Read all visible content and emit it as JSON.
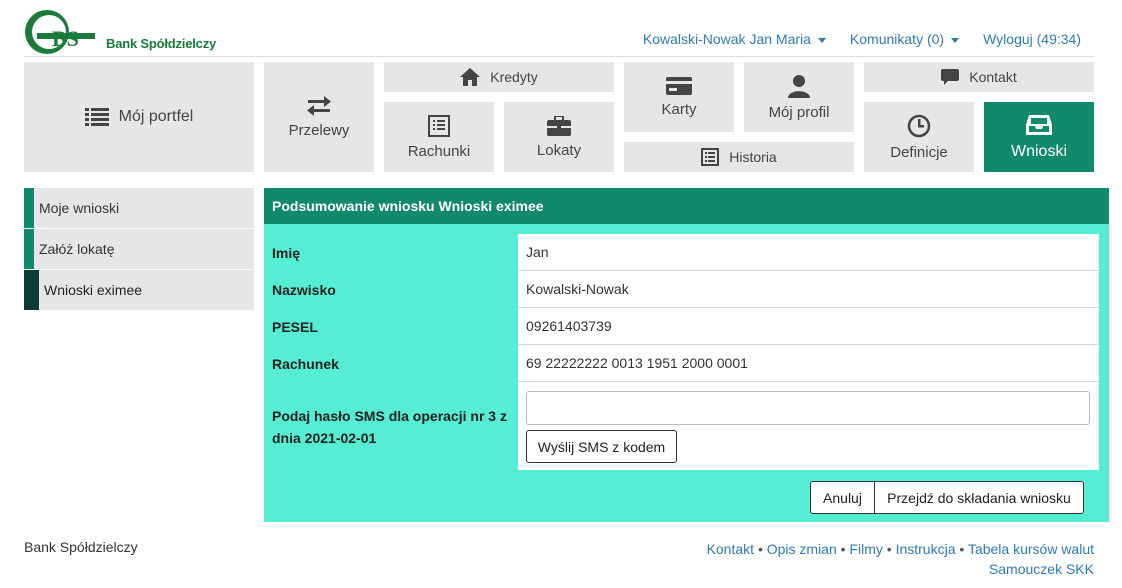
{
  "header": {
    "logo_text": "Bank Spółdzielczy",
    "user_name": "Kowalski-Nowak Jan Maria",
    "messages": "Komunikaty (0)",
    "logout": "Wyloguj (49:34)"
  },
  "tiles": {
    "portfel": "Mój portfel",
    "przelewy": "Przelewy",
    "kredyty": "Kredyty",
    "rachunki": "Rachunki",
    "lokaty": "Lokaty",
    "karty": "Karty",
    "historia": "Historia",
    "profil": "Mój profil",
    "kontakt": "Kontakt",
    "definicje": "Definicje",
    "wnioski": "Wnioski"
  },
  "sidebar": {
    "items": [
      {
        "label": "Moje wnioski"
      },
      {
        "label": "Załóż lokatę"
      },
      {
        "label": "Wnioski eximee"
      }
    ]
  },
  "panel": {
    "title": "Podsumowanie wniosku Wnioski eximee",
    "fields": [
      {
        "label": "Imię",
        "value": "Jan"
      },
      {
        "label": "Nazwisko",
        "value": "Kowalski-Nowak"
      },
      {
        "label": "PESEL",
        "value": "09261403739"
      },
      {
        "label": "Rachunek",
        "value": "69 22222222 0013 1951 2000 0001"
      }
    ],
    "sms_label": "Podaj hasło SMS dla operacji nr 3 z dnia 2021-02-01",
    "sms_value": "",
    "send_sms": "Wyślij SMS z kodem",
    "cancel": "Anuluj",
    "proceed": "Przejdź do składania wniosku"
  },
  "footer": {
    "bank": "Bank Spółdzielczy",
    "links": [
      "Kontakt",
      "Opis zmian",
      "Filmy",
      "Instrukcja",
      "Tabela kursów walut",
      "Samouczek SKK"
    ]
  },
  "colors": {
    "accent": "#108a6a",
    "panel_bg": "#55eed2",
    "link": "#2f7bb5",
    "tile_bg": "#e6e6e6"
  }
}
